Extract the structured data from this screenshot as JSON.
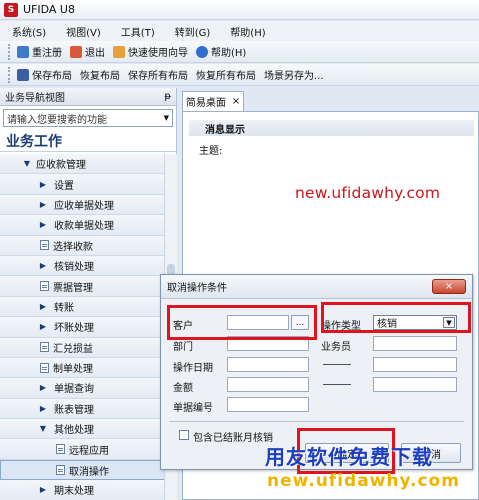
{
  "app": {
    "logo_text": "S",
    "title": "UFIDA U8"
  },
  "menu": [
    {
      "label": "系统(S)"
    },
    {
      "label": "视图(V)"
    },
    {
      "label": "工具(T)"
    },
    {
      "label": "转到(G)"
    },
    {
      "label": "帮助(H)"
    }
  ],
  "toolbar1": {
    "relogin": "重注册",
    "exit": "退出",
    "quick_guide": "快速使用向导",
    "help": "帮助(H)"
  },
  "toolbar2": {
    "save_layout": "保存布局",
    "restore_layout": "恢复布局",
    "save_all_layouts": "保存所有布局",
    "restore_all_layouts": "恢复所有布局",
    "scene_save_as": "场景另存为..."
  },
  "nav": {
    "header": "业务导航视图",
    "pin": "ᵽ",
    "search_placeholder": "请输入您要搜索的功能",
    "section": "业务工作",
    "items": [
      {
        "label": "应收款管理",
        "mark": "▼"
      },
      {
        "label": "设置",
        "mark": "▶"
      },
      {
        "label": "应收单据处理",
        "mark": "▶"
      },
      {
        "label": "收款单据处理",
        "mark": "▶"
      },
      {
        "label": "选择收款",
        "mark": ""
      },
      {
        "label": "核销处理",
        "mark": "▶"
      },
      {
        "label": "票据管理",
        "mark": ""
      },
      {
        "label": "转账",
        "mark": "▶"
      },
      {
        "label": "坏账处理",
        "mark": "▶"
      },
      {
        "label": "汇兑损益",
        "mark": ""
      },
      {
        "label": "制单处理",
        "mark": ""
      },
      {
        "label": "单据查询",
        "mark": "▶"
      },
      {
        "label": "账表管理",
        "mark": "▶"
      },
      {
        "label": "其他处理",
        "mark": "▼"
      },
      {
        "label": "远程应用",
        "mark": ""
      },
      {
        "label": "取消操作",
        "mark": ""
      },
      {
        "label": "期末处理",
        "mark": "▶"
      }
    ]
  },
  "workspace": {
    "tab_label": "简易桌面",
    "tab_close": "×",
    "message_header": "消息显示",
    "subject_label": "主题:",
    "watermark_url": "new.ufidawhy.com"
  },
  "dialog": {
    "title": "取消操作条件",
    "close": "×",
    "customer_label": "客户",
    "browse": "...",
    "op_type_label": "操作类型",
    "op_type_value": "核销",
    "dropdown_arrow": "▼",
    "dept_label": "部门",
    "salesman_label": "业务员",
    "op_date_label": "操作日期",
    "amount_label": "金额",
    "doc_no_label": "单据编号",
    "include_closed_label": "包含已结账月核销",
    "confirm": "确定",
    "cancel": "取消"
  },
  "watermarks": {
    "brand": "用友软件免费下载",
    "url": "new.ufidawhy.com"
  },
  "colors": {
    "highlight": "#e0141e",
    "brand_blue": "#1d3fbf",
    "brand_gold": "#f0b400"
  }
}
